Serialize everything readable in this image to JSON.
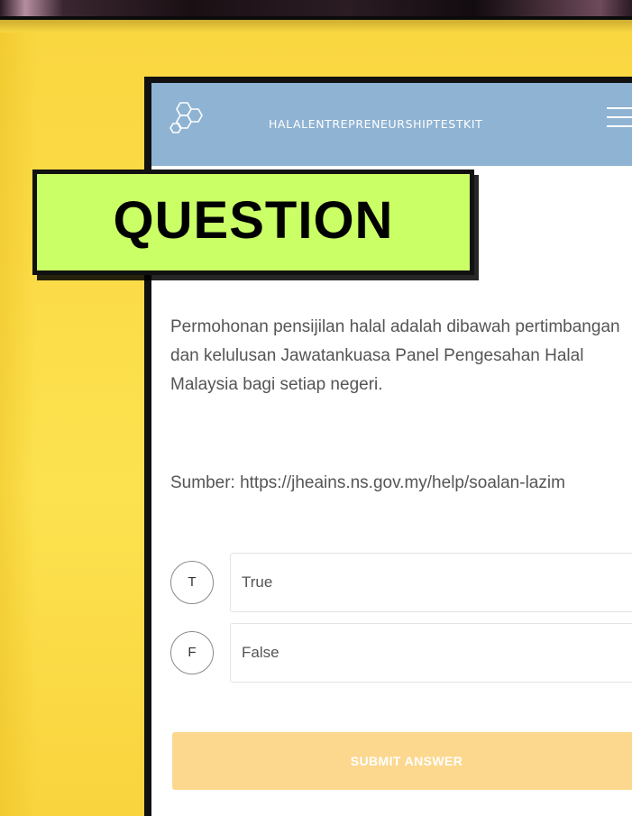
{
  "overlay_label": "QUESTION",
  "app": {
    "title": "HALALENTREPRENEURSHIPTESTKIT"
  },
  "question": {
    "text": "Permohonan pensijilan halal adalah dibawah pertimbangan dan kelulusan Jawatankuasa Panel Pengesahan Halal Malaysia bagi setiap negeri.",
    "source": "Sumber: https://jheains.ns.gov.my/help/soalan-lazim"
  },
  "options": [
    {
      "badge": "T",
      "label": "True"
    },
    {
      "badge": "F",
      "label": "False"
    }
  ],
  "submit_label": "SUBMIT ANSWER",
  "colors": {
    "background": "#fbdc48",
    "appbar": "#8fb3d3",
    "submit": "#fcd88f",
    "overlay": "#caff66"
  },
  "icons": {
    "logo": "hexagon-molecule-icon",
    "menu": "hamburger-menu-icon"
  }
}
